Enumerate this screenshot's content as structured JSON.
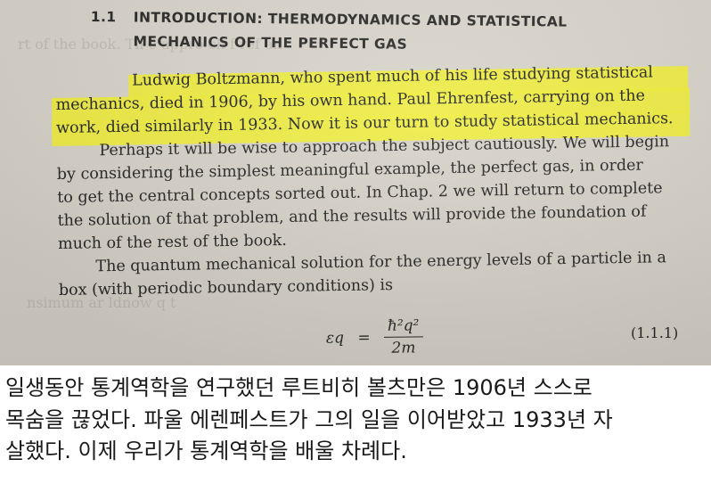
{
  "book_page": {
    "section_number": "1.1",
    "section_title_line1": "INTRODUCTION: THERMODYNAMICS AND STATISTICAL",
    "section_title_line2": "MECHANICS OF THE PERFECT GAS",
    "paragraph_lines": [
      "Ludwig Boltzmann, who spent much of his life studying statistical",
      "mechanics, died in 1906, by his own hand. Paul Ehrenfest, carrying on the",
      "work, died similarly in 1933. Now it is our turn to study statistical mechanics.",
      "Perhaps it will be wise to approach the subject cautiously. We will begin",
      "by considering the simplest meaningful example, the perfect gas, in order",
      "to get the central concepts sorted out. In Chap. 2 we will return to complete",
      "the solution of that problem, and the results will provide the foundation of",
      "much of the rest of the book.",
      "The quantum mechanical solution for the energy levels of a particle in a",
      "box (with periodic boundary conditions) is"
    ],
    "equation": {
      "lhs": "εq",
      "equals": "=",
      "numerator": "ħ²q²",
      "denominator": "2m",
      "label": "(1.1.1)"
    },
    "highlight_color": "#f0ee3a"
  },
  "caption": {
    "lines": [
      "일생동안 통계역학을 연구했던 루트비히 볼츠만은 1906년 스스로",
      "목숨을 끊었다. 파울 에렌페스트가 그의 일을 이어받았고 1933년 자",
      "살했다. 이제 우리가 통계역학을 배울 차례다."
    ]
  }
}
